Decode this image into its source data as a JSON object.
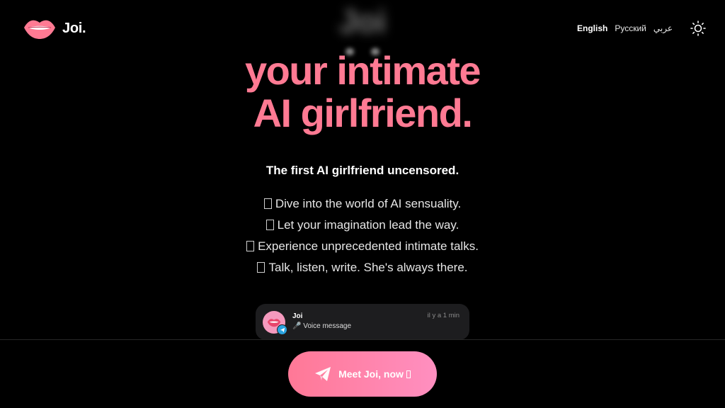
{
  "brand": {
    "name": "Joi."
  },
  "languages": [
    {
      "label": "English",
      "active": true
    },
    {
      "label": "Русский",
      "active": false
    },
    {
      "label": "عربي",
      "active": false
    }
  ],
  "hero": {
    "blurred_word": "Joi",
    "headline_line1": "your intimate",
    "headline_line2": "AI girlfriend."
  },
  "tagline": "The first AI girlfriend uncensored.",
  "features": [
    "Dive into the world of AI sensuality.",
    "Let your imagination lead the way.",
    "Experience unprecedented intimate talks.",
    "Talk, listen, write. She's always there."
  ],
  "notification": {
    "name": "Joi",
    "message": "🎤 Voice message",
    "time": "il y a 1 min"
  },
  "cta": {
    "label": "Meet Joi, now"
  },
  "colors": {
    "accent": "#ff7a93",
    "cta_start": "#ff7896",
    "cta_end": "#ff8fc0",
    "background": "#000000"
  },
  "icons": {
    "logo": "lips-icon",
    "theme": "sun-icon",
    "cta": "telegram-send-icon"
  }
}
